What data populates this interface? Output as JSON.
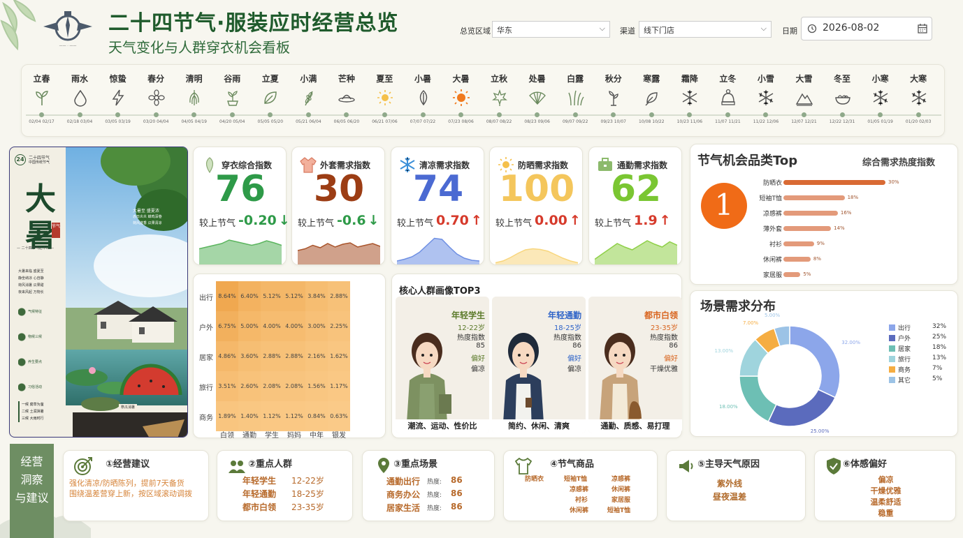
{
  "header": {
    "title": "二十四节气·服装应时经营总览",
    "subtitle": "天气变化与人群穿衣机会看板"
  },
  "filters": {
    "region_label": "总览区域",
    "region_value": "华东",
    "channel_label": "渠道",
    "channel_value": "线下门店",
    "date_label": "日期",
    "date_value": "2026-08-02"
  },
  "terms": [
    {
      "name": "立春",
      "dates": "02/04 02/17",
      "icon": "sprout-icon"
    },
    {
      "name": "雨水",
      "dates": "02/18 03/04",
      "icon": "raindrop-icon"
    },
    {
      "name": "惊蛰",
      "dates": "03/05 03/19",
      "icon": "lightning-icon"
    },
    {
      "name": "春分",
      "dates": "03/20 04/04",
      "icon": "flower-icon"
    },
    {
      "name": "清明",
      "dates": "04/05 04/19",
      "icon": "willow-icon"
    },
    {
      "name": "谷雨",
      "dates": "04/20 05/04",
      "icon": "sprout-cup-icon"
    },
    {
      "name": "立夏",
      "dates": "05/05 05/20",
      "icon": "leaf-icon"
    },
    {
      "name": "小满",
      "dates": "05/21 06/04",
      "icon": "wheat-icon"
    },
    {
      "name": "芒种",
      "dates": "06/05 06/20",
      "icon": "hat-icon"
    },
    {
      "name": "夏至",
      "dates": "06/21 07/06",
      "icon": "sun-icon"
    },
    {
      "name": "小暑",
      "dates": "07/07 07/22",
      "icon": "leaf-outline-icon"
    },
    {
      "name": "大暑",
      "dates": "07/23 08/06",
      "icon": "hot-sun-icon"
    },
    {
      "name": "立秋",
      "dates": "08/07 08/22",
      "icon": "maple-leaf-icon"
    },
    {
      "name": "处暑",
      "dates": "08/23 09/06",
      "icon": "fan-icon"
    },
    {
      "name": "白露",
      "dates": "09/07 09/22",
      "icon": "grass-icon"
    },
    {
      "name": "秋分",
      "dates": "09/23 10/07",
      "icon": "seedling-icon"
    },
    {
      "name": "寒露",
      "dates": "10/08 10/22",
      "icon": "falling-leaf-icon"
    },
    {
      "name": "霜降",
      "dates": "10/23 11/06",
      "icon": "frost-icon"
    },
    {
      "name": "立冬",
      "dates": "11/07 11/21",
      "icon": "winter-hat-icon"
    },
    {
      "name": "小雪",
      "dates": "11/22 12/06",
      "icon": "snowflake-icon"
    },
    {
      "name": "大雪",
      "dates": "12/07 12/21",
      "icon": "mountain-icon"
    },
    {
      "name": "冬至",
      "dates": "12/22 12/31",
      "icon": "dumpling-bowl-icon"
    },
    {
      "name": "小寒",
      "dates": "01/05 01/19",
      "icon": "snowflake-icon"
    },
    {
      "name": "大寒",
      "dates": "01/20 02/03",
      "icon": "snowflake-icon"
    }
  ],
  "poster": {
    "badge": "24",
    "badge_line1": "二十四节气",
    "badge_line2": "中国传统节气",
    "big1": "大",
    "big2": "暑",
    "seal": "节气",
    "sub": "— 二十四节气之十二 —",
    "desc1": "大暑至 盛夏浓",
    "desc2": "赤日炎炎 蝉鸣深巷",
    "desc3": "荷风送香 瓜果清凉",
    "notes": [
      "大暑来临 盛夏至",
      "静坐纳凉 心自静",
      "荷风消暑 瓜果甜",
      "夜来风起 万物长"
    ],
    "features": [
      "气候特征",
      "物候三候",
      "养生要点",
      "习俗活动"
    ],
    "bottom": [
      "一候 腐草为萤",
      "二候 土润溽暑",
      "三候 大雨时行"
    ],
    "fruit_title": "祭瓜消暑"
  },
  "index_cards": [
    {
      "title": "穿衣综合指数",
      "value": "76",
      "compare_label": "较上节气",
      "change": "-0.20",
      "arrow": "↓",
      "value_color": "#2e9a48",
      "change_color": "#2e9a48",
      "icon": "shirt-leaf-icon",
      "wave_color": "#5bb55e",
      "wave": [
        0.45,
        0.5,
        0.55,
        0.6,
        0.7,
        0.65,
        0.6,
        0.55,
        0.6,
        0.68,
        0.62,
        0.55
      ]
    },
    {
      "title": "外套需求指数",
      "value": "30",
      "compare_label": "较上节气",
      "change": "-0.6",
      "arrow": "↓",
      "value_color": "#9c3d14",
      "change_color": "#2e9a48",
      "icon": "jacket-icon",
      "wave_color": "#a9542b",
      "wave": [
        0.4,
        0.45,
        0.55,
        0.48,
        0.6,
        0.5,
        0.58,
        0.62,
        0.5,
        0.55,
        0.6,
        0.52
      ]
    },
    {
      "title": "清凉需求指数",
      "value": "74",
      "compare_label": "较上节气",
      "change": "0.70",
      "arrow": "↑",
      "value_color": "#4b6ad2",
      "change_color": "#d63a2b",
      "icon": "snowflake-icon",
      "wave_color": "#6e8fe3",
      "wave": [
        0.1,
        0.15,
        0.22,
        0.35,
        0.55,
        0.75,
        0.72,
        0.5,
        0.3,
        0.18,
        0.12,
        0.1
      ]
    },
    {
      "title": "防晒需求指数",
      "value": "100",
      "compare_label": "较上节气",
      "change": "0.00",
      "arrow": "↑",
      "value_color": "#f4c65c",
      "change_color": "#d63a2b",
      "icon": "sun-icon",
      "wave_color": "#f8d67d",
      "wave": [
        0.05,
        0.1,
        0.2,
        0.32,
        0.42,
        0.45,
        0.43,
        0.38,
        0.28,
        0.18,
        0.1,
        0.05
      ]
    },
    {
      "title": "通勤需求指数",
      "value": "62",
      "compare_label": "较上节气",
      "change": "1.9",
      "arrow": "↑",
      "value_color": "#7ac632",
      "change_color": "#d63a2b",
      "icon": "briefcase-icon",
      "wave_color": "#8fd048",
      "wave": [
        0.15,
        0.3,
        0.45,
        0.6,
        0.5,
        0.42,
        0.55,
        0.68,
        0.58,
        0.5,
        0.65,
        0.55
      ]
    }
  ],
  "heatmap": {
    "rows": [
      "出行",
      "户外",
      "居家",
      "旅行",
      "商务"
    ],
    "cols": [
      "白领",
      "通勤",
      "学生",
      "妈妈",
      "中年",
      "银发"
    ],
    "values": [
      [
        8.64,
        6.4,
        5.12,
        5.12,
        3.84,
        2.88
      ],
      [
        6.75,
        5.0,
        4.0,
        4.0,
        3.0,
        2.25
      ],
      [
        4.86,
        3.6,
        2.88,
        2.88,
        2.16,
        1.62
      ],
      [
        3.51,
        2.6,
        2.08,
        2.08,
        1.56,
        1.17
      ],
      [
        1.89,
        1.4,
        1.12,
        1.12,
        0.84,
        0.63
      ]
    ],
    "labels": [
      [
        "8.64%",
        "6.40%",
        "5.12%",
        "5.12%",
        "3.84%",
        "2.88%"
      ],
      [
        "6.75%",
        "5.00%",
        "4.00%",
        "4.00%",
        "3.00%",
        "2.25%"
      ],
      [
        "4.86%",
        "3.60%",
        "2.88%",
        "2.88%",
        "2.16%",
        "1.62%"
      ],
      [
        "3.51%",
        "2.60%",
        "2.08%",
        "2.08%",
        "1.56%",
        "1.17%"
      ],
      [
        "1.89%",
        "1.40%",
        "1.12%",
        "1.12%",
        "0.84%",
        "0.63%"
      ]
    ]
  },
  "persona": {
    "title": "核心人群画像TOP3",
    "people": [
      {
        "name": "年轻学生",
        "age": "12-22岁",
        "heat_label": "热度指数",
        "heat": "85",
        "pref_label": "偏好",
        "pref": "偏凉",
        "tag": "潮流、运动、性价比",
        "color": "#5b7a2a"
      },
      {
        "name": "年轻通勤",
        "age": "18-25岁",
        "heat_label": "热度指数",
        "heat": "86",
        "pref_label": "偏好",
        "pref": "偏凉",
        "tag": "简约、休闲、清爽",
        "color": "#2f64c8"
      },
      {
        "name": "都市白领",
        "age": "23-35岁",
        "heat_label": "热度指数",
        "heat": "86",
        "pref_label": "偏好",
        "pref": "干燥优雅",
        "tag": "通勤、质感、易打理",
        "color": "#d9651f"
      }
    ]
  },
  "top_category": {
    "title": "节气机会品类Top",
    "subtitle": "综合需求热度指数",
    "rank": "1",
    "chart_data": {
      "type": "bar",
      "categories": [
        "防晒衣",
        "短袖T恤",
        "凉感裤",
        "薄外套",
        "衬衫",
        "休闲裤",
        "家居服"
      ],
      "values": [
        30,
        18,
        16,
        14,
        9,
        8,
        5
      ],
      "labels": [
        "30%",
        "18%",
        "16%",
        "14%",
        "9%",
        "8%",
        "5%"
      ]
    }
  },
  "scene": {
    "title": "场景需求分布",
    "chart_data": {
      "type": "pie",
      "categories": [
        "出行",
        "户外",
        "居家",
        "旅行",
        "商务",
        "其它"
      ],
      "values": [
        32,
        25,
        18,
        13,
        7,
        5
      ],
      "labels": [
        "32.00%",
        "25.00%",
        "18.00%",
        "13.00%",
        "7.00%",
        "5.00%"
      ],
      "legend_values": [
        "32%",
        "25%",
        "18%",
        "13%",
        "7%",
        "5%"
      ],
      "colors": [
        "#8ca6ea",
        "#5b6bbd",
        "#6dbfb4",
        "#9fd4dd",
        "#f5ad42",
        "#9cc3e6"
      ]
    }
  },
  "insight": {
    "side_lines": [
      "经营",
      "洞察",
      "与建议"
    ],
    "advice": {
      "title": "①经营建议",
      "lines": [
        "强化清凉/防晒陈列，提前7天备货",
        "围绕温差营穿上新，按区域滚动调拨"
      ]
    },
    "crowd": {
      "title": "②重点人群",
      "rows": [
        [
          "年轻学生",
          "12-22岁"
        ],
        [
          "年轻通勤",
          "18-25岁"
        ],
        [
          "都市白领",
          "23-35岁"
        ]
      ]
    },
    "scenes": {
      "title": "③重点场景",
      "rows": [
        [
          "通勤出行",
          "热度:",
          "86"
        ],
        [
          "商务办公",
          "热度:",
          "86"
        ],
        [
          "居家生活",
          "热度:",
          "86"
        ]
      ]
    },
    "goods": {
      "title": "④节气商品",
      "items": [
        "防晒衣",
        "短袖T恤",
        "凉感裤",
        "凉感裤",
        "休闲裤",
        "衬衫",
        "家居服",
        "休闲裤",
        "短袖T恤"
      ]
    },
    "weather": {
      "title": "⑤主导天气原因",
      "lines": [
        "紫外线",
        "昼夜温差"
      ]
    },
    "feel": {
      "title": "⑥体感偏好",
      "lines": [
        "偏凉",
        "干燥优雅",
        "温柔舒适",
        "稳重"
      ]
    }
  }
}
